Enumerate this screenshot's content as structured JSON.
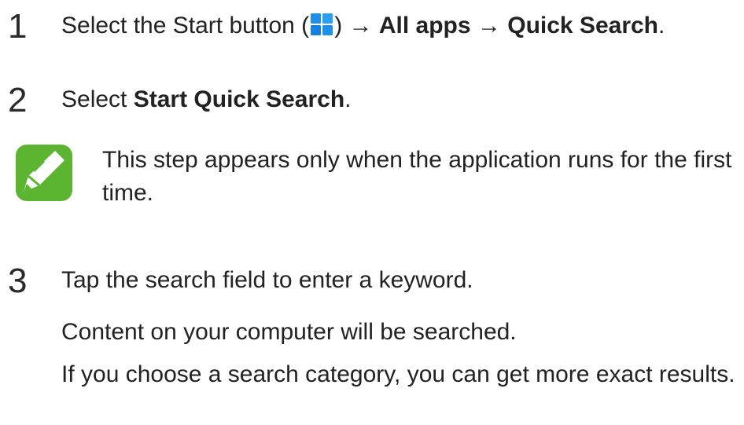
{
  "steps": [
    {
      "number": "1",
      "prefix": "Select the Start button (",
      "icon": "windows-start-icon",
      "after_icon": ") → ",
      "bold1": "All apps",
      "arrow": " → ",
      "bold2": "Quick Search",
      "suffix": "."
    },
    {
      "number": "2",
      "prefix": "Select ",
      "bold1": "Start Quick Search",
      "suffix": "."
    },
    {
      "number": "3",
      "text": "Tap the search field to enter a keyword.",
      "paragraphs": [
        "Content on your computer will be searched.",
        "If you choose a search category, you can get more exact results."
      ]
    }
  ],
  "note": {
    "icon": "note-pencil-icon",
    "text": "This step appears only when the application runs for the first time."
  },
  "colors": {
    "note_green": "#5cb531",
    "windows_blue": "#1e90e6"
  }
}
